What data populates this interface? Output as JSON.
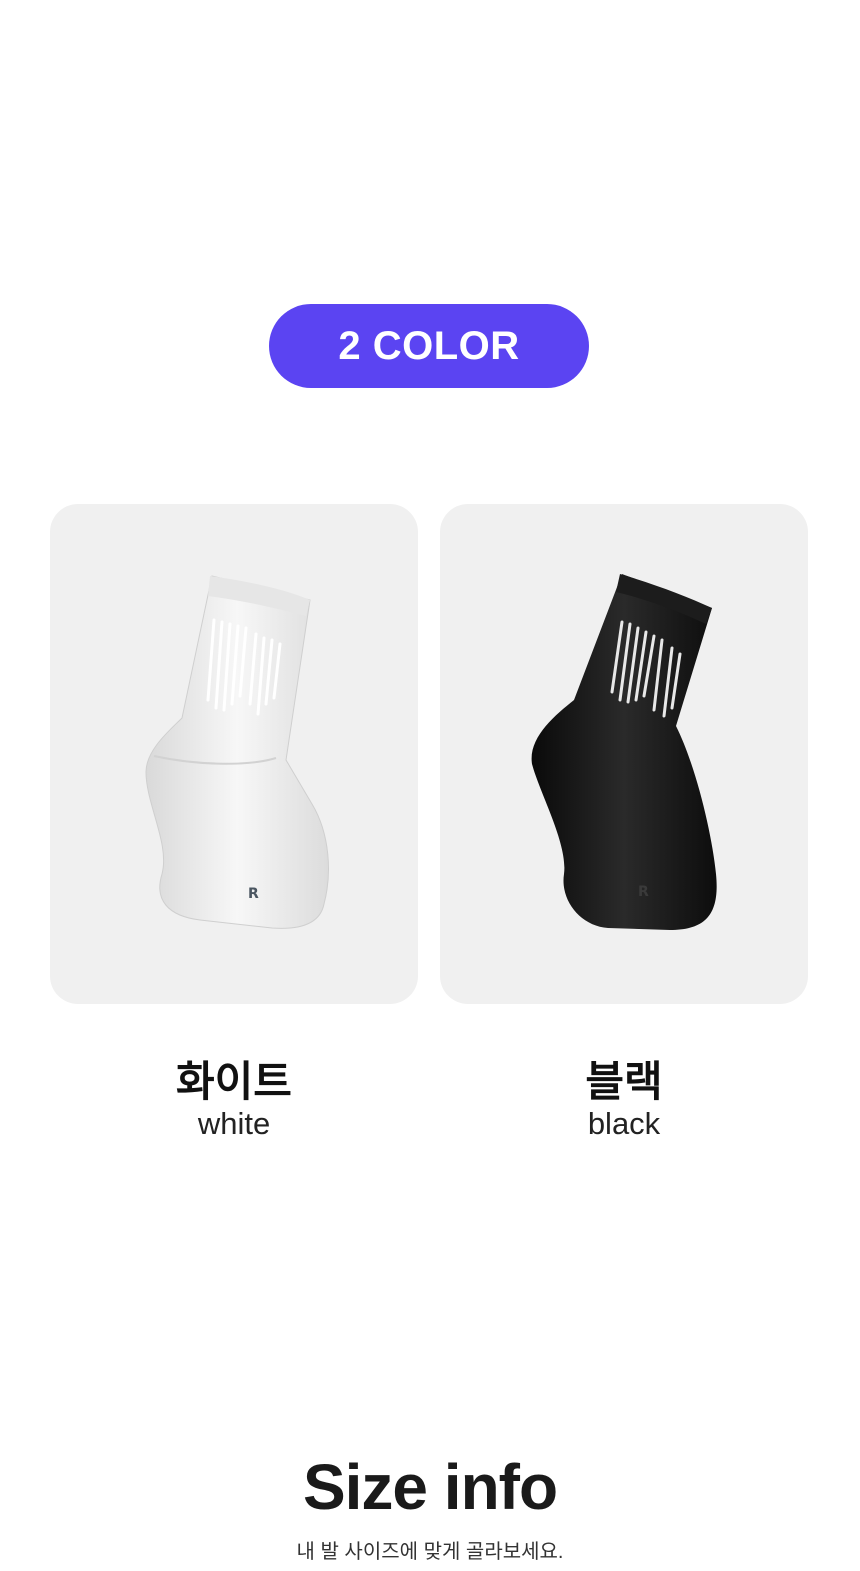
{
  "colors": {
    "accent": "#5b44f2",
    "card_bg": "#f0f0f0"
  },
  "badge": {
    "label": "2 COLOR"
  },
  "products": [
    {
      "name_ko": "화이트",
      "name_en": "white",
      "sock_color": "#f4f4f4"
    },
    {
      "name_ko": "블랙",
      "name_en": "black",
      "sock_color": "#141414"
    }
  ],
  "size_info": {
    "title": "Size info",
    "subtitle": "내 발 사이즈에 맞게 골라보세요."
  }
}
